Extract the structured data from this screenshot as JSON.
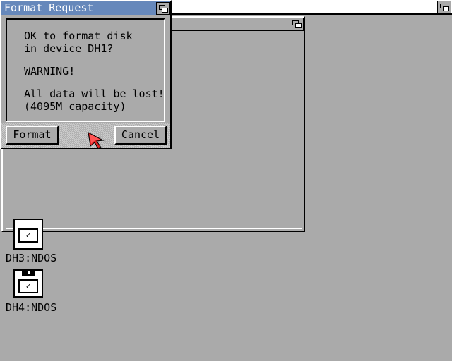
{
  "screen": {
    "title": "",
    "background_color": "#aaaaaa"
  },
  "dialog": {
    "title": "Format Request",
    "message_lines": [
      "OK to format disk",
      "in device DH1?",
      "WARNING!",
      "All data will be lost!",
      "(4095M capacity)"
    ],
    "format_label": "Format",
    "cancel_label": "Cancel",
    "title_color": "#6688bb"
  },
  "icons": [
    {
      "name": "disk-icon",
      "caption": "DH3:NDOS"
    },
    {
      "name": "disk-icon",
      "caption": "DH4:NDOS"
    }
  ],
  "pointer": {
    "name": "mouse-pointer-icon",
    "color": "#dd2222"
  }
}
